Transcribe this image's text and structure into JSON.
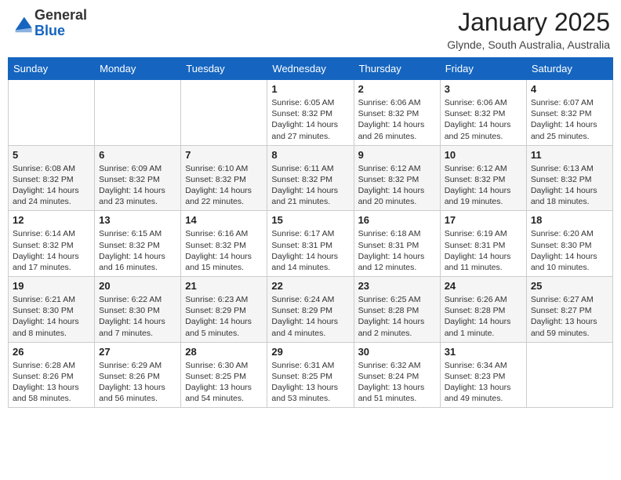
{
  "header": {
    "logo_general": "General",
    "logo_blue": "Blue",
    "month_title": "January 2025",
    "location": "Glynde, South Australia, Australia"
  },
  "weekdays": [
    "Sunday",
    "Monday",
    "Tuesday",
    "Wednesday",
    "Thursday",
    "Friday",
    "Saturday"
  ],
  "weeks": [
    [
      {
        "day": "",
        "info": ""
      },
      {
        "day": "",
        "info": ""
      },
      {
        "day": "",
        "info": ""
      },
      {
        "day": "1",
        "info": "Sunrise: 6:05 AM\nSunset: 8:32 PM\nDaylight: 14 hours and 27 minutes."
      },
      {
        "day": "2",
        "info": "Sunrise: 6:06 AM\nSunset: 8:32 PM\nDaylight: 14 hours and 26 minutes."
      },
      {
        "day": "3",
        "info": "Sunrise: 6:06 AM\nSunset: 8:32 PM\nDaylight: 14 hours and 25 minutes."
      },
      {
        "day": "4",
        "info": "Sunrise: 6:07 AM\nSunset: 8:32 PM\nDaylight: 14 hours and 25 minutes."
      }
    ],
    [
      {
        "day": "5",
        "info": "Sunrise: 6:08 AM\nSunset: 8:32 PM\nDaylight: 14 hours and 24 minutes."
      },
      {
        "day": "6",
        "info": "Sunrise: 6:09 AM\nSunset: 8:32 PM\nDaylight: 14 hours and 23 minutes."
      },
      {
        "day": "7",
        "info": "Sunrise: 6:10 AM\nSunset: 8:32 PM\nDaylight: 14 hours and 22 minutes."
      },
      {
        "day": "8",
        "info": "Sunrise: 6:11 AM\nSunset: 8:32 PM\nDaylight: 14 hours and 21 minutes."
      },
      {
        "day": "9",
        "info": "Sunrise: 6:12 AM\nSunset: 8:32 PM\nDaylight: 14 hours and 20 minutes."
      },
      {
        "day": "10",
        "info": "Sunrise: 6:12 AM\nSunset: 8:32 PM\nDaylight: 14 hours and 19 minutes."
      },
      {
        "day": "11",
        "info": "Sunrise: 6:13 AM\nSunset: 8:32 PM\nDaylight: 14 hours and 18 minutes."
      }
    ],
    [
      {
        "day": "12",
        "info": "Sunrise: 6:14 AM\nSunset: 8:32 PM\nDaylight: 14 hours and 17 minutes."
      },
      {
        "day": "13",
        "info": "Sunrise: 6:15 AM\nSunset: 8:32 PM\nDaylight: 14 hours and 16 minutes."
      },
      {
        "day": "14",
        "info": "Sunrise: 6:16 AM\nSunset: 8:32 PM\nDaylight: 14 hours and 15 minutes."
      },
      {
        "day": "15",
        "info": "Sunrise: 6:17 AM\nSunset: 8:31 PM\nDaylight: 14 hours and 14 minutes."
      },
      {
        "day": "16",
        "info": "Sunrise: 6:18 AM\nSunset: 8:31 PM\nDaylight: 14 hours and 12 minutes."
      },
      {
        "day": "17",
        "info": "Sunrise: 6:19 AM\nSunset: 8:31 PM\nDaylight: 14 hours and 11 minutes."
      },
      {
        "day": "18",
        "info": "Sunrise: 6:20 AM\nSunset: 8:30 PM\nDaylight: 14 hours and 10 minutes."
      }
    ],
    [
      {
        "day": "19",
        "info": "Sunrise: 6:21 AM\nSunset: 8:30 PM\nDaylight: 14 hours and 8 minutes."
      },
      {
        "day": "20",
        "info": "Sunrise: 6:22 AM\nSunset: 8:30 PM\nDaylight: 14 hours and 7 minutes."
      },
      {
        "day": "21",
        "info": "Sunrise: 6:23 AM\nSunset: 8:29 PM\nDaylight: 14 hours and 5 minutes."
      },
      {
        "day": "22",
        "info": "Sunrise: 6:24 AM\nSunset: 8:29 PM\nDaylight: 14 hours and 4 minutes."
      },
      {
        "day": "23",
        "info": "Sunrise: 6:25 AM\nSunset: 8:28 PM\nDaylight: 14 hours and 2 minutes."
      },
      {
        "day": "24",
        "info": "Sunrise: 6:26 AM\nSunset: 8:28 PM\nDaylight: 14 hours and 1 minute."
      },
      {
        "day": "25",
        "info": "Sunrise: 6:27 AM\nSunset: 8:27 PM\nDaylight: 13 hours and 59 minutes."
      }
    ],
    [
      {
        "day": "26",
        "info": "Sunrise: 6:28 AM\nSunset: 8:26 PM\nDaylight: 13 hours and 58 minutes."
      },
      {
        "day": "27",
        "info": "Sunrise: 6:29 AM\nSunset: 8:26 PM\nDaylight: 13 hours and 56 minutes."
      },
      {
        "day": "28",
        "info": "Sunrise: 6:30 AM\nSunset: 8:25 PM\nDaylight: 13 hours and 54 minutes."
      },
      {
        "day": "29",
        "info": "Sunrise: 6:31 AM\nSunset: 8:25 PM\nDaylight: 13 hours and 53 minutes."
      },
      {
        "day": "30",
        "info": "Sunrise: 6:32 AM\nSunset: 8:24 PM\nDaylight: 13 hours and 51 minutes."
      },
      {
        "day": "31",
        "info": "Sunrise: 6:34 AM\nSunset: 8:23 PM\nDaylight: 13 hours and 49 minutes."
      },
      {
        "day": "",
        "info": ""
      }
    ]
  ]
}
